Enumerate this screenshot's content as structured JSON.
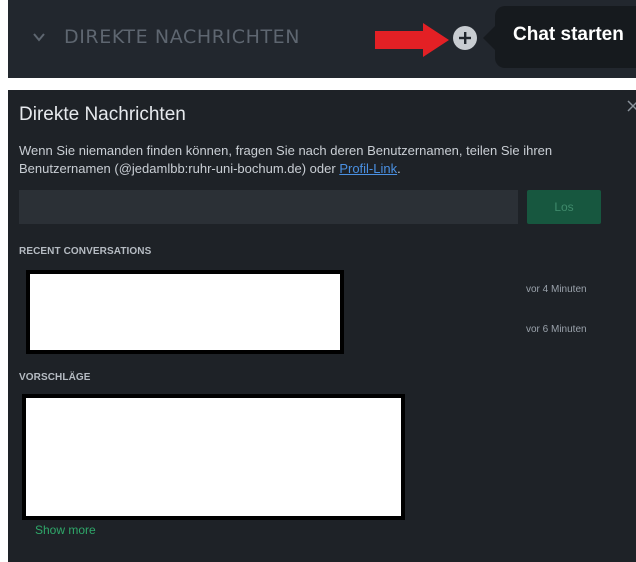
{
  "top_strip": {
    "dm_header_label": "DIREKTE NACHRICHTEN",
    "tooltip": "Chat starten",
    "icons": [
      "chevron-down-icon",
      "red-arrow-icon",
      "plus-icon"
    ],
    "colors": {
      "arrow": "#e32025",
      "tooltip_bg": "#161a1e",
      "strip_bg": "#22272e"
    }
  },
  "modal": {
    "title": "Direkte Nachrichten",
    "help_text_before_link": "Wenn Sie niemanden finden können, fragen Sie nach deren Benutzernamen, teilen Sie ihren Benutzernamen (@jedamlbb:ruhr-uni-bochum.de) oder ",
    "help_link": "Profil-Link",
    "help_text_after_link": ".",
    "search": {
      "value": "",
      "placeholder": ""
    },
    "go_button": "Los",
    "recent_label": "RECENT CONVERSATIONS",
    "recent_times": [
      "vor 4 Minuten",
      "vor 6 Minuten"
    ],
    "suggestions_label": "VORSCHLÄGE",
    "show_more": "Show more",
    "colors": {
      "bg": "#1e2227",
      "accent": "#17573f",
      "link": "#4a90e2",
      "show_more": "#2fa86a"
    }
  }
}
